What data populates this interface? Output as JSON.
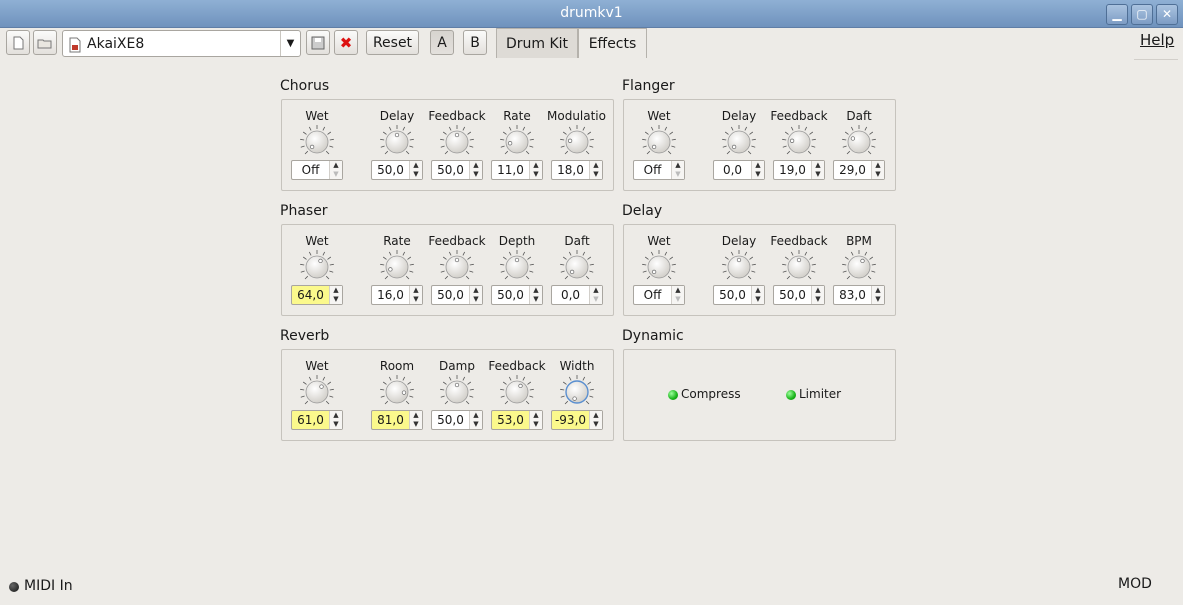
{
  "window": {
    "title": "drumkv1"
  },
  "toolbar": {
    "preset": "AkaiXE8",
    "reset_label": "Reset",
    "a_label": "A",
    "b_label": "B",
    "tabs": [
      {
        "label": "Drum Kit",
        "active": false
      },
      {
        "label": "Effects",
        "active": true
      }
    ],
    "help_label": "Help"
  },
  "sections": {
    "chorus": {
      "title": "Chorus",
      "knobs": [
        {
          "label": "Wet",
          "value": "Off"
        },
        {
          "label": "Delay",
          "value": "50,0"
        },
        {
          "label": "Feedback",
          "value": "50,0"
        },
        {
          "label": "Rate",
          "value": "11,0"
        },
        {
          "label": "Modulation",
          "value": "18,0"
        }
      ]
    },
    "flanger": {
      "title": "Flanger",
      "knobs": [
        {
          "label": "Wet",
          "value": "Off"
        },
        {
          "label": "Delay",
          "value": "0,0"
        },
        {
          "label": "Feedback",
          "value": "19,0"
        },
        {
          "label": "Daft",
          "value": "29,0"
        }
      ]
    },
    "phaser": {
      "title": "Phaser",
      "knobs": [
        {
          "label": "Wet",
          "value": "64,0"
        },
        {
          "label": "Rate",
          "value": "16,0"
        },
        {
          "label": "Feedback",
          "value": "50,0"
        },
        {
          "label": "Depth",
          "value": "50,0"
        },
        {
          "label": "Daft",
          "value": "0,0"
        }
      ]
    },
    "delay": {
      "title": "Delay",
      "knobs": [
        {
          "label": "Wet",
          "value": "Off"
        },
        {
          "label": "Delay",
          "value": "50,0"
        },
        {
          "label": "Feedback",
          "value": "50,0"
        },
        {
          "label": "BPM",
          "value": "83,0"
        }
      ]
    },
    "reverb": {
      "title": "Reverb",
      "knobs": [
        {
          "label": "Wet",
          "value": "61,0"
        },
        {
          "label": "Room",
          "value": "81,0"
        },
        {
          "label": "Damp",
          "value": "50,0"
        },
        {
          "label": "Feedback",
          "value": "53,0"
        },
        {
          "label": "Width",
          "value": "-93,0"
        }
      ]
    },
    "dynamic": {
      "title": "Dynamic",
      "compress_label": "Compress",
      "limiter_label": "Limiter"
    }
  },
  "status": {
    "midi_label": "MIDI In",
    "mod_label": "MOD"
  },
  "colors": {
    "highlight": "#fbf98c",
    "led_on": "#18b318"
  }
}
